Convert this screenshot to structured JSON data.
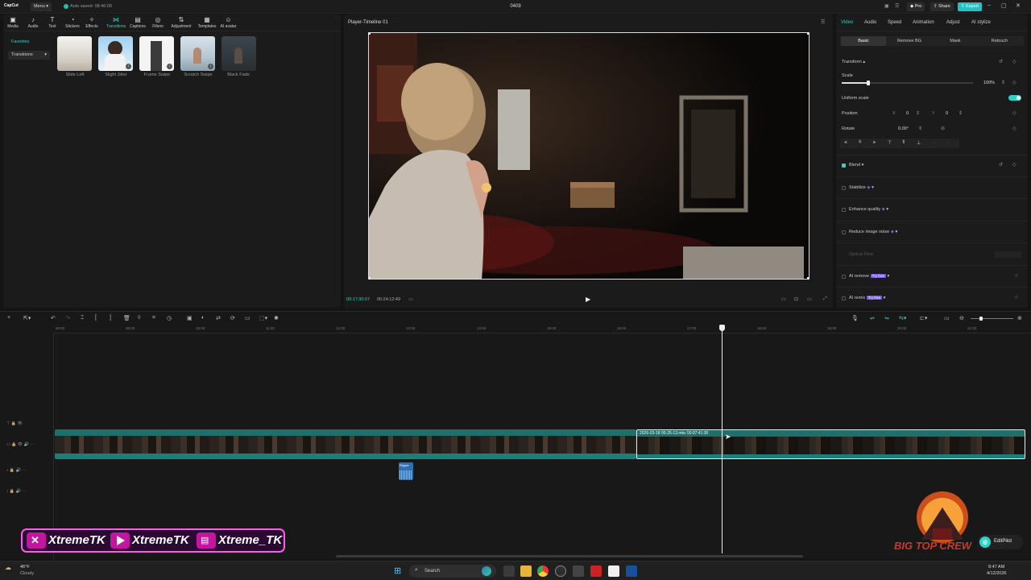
{
  "app": {
    "logo_text": "CapCut",
    "menu_label": "Menu",
    "autosave": "Auto saved: 08:46:09",
    "title": "0409",
    "pro_label": "Pro",
    "share_label": "Share",
    "export_label": "Export"
  },
  "toolbar": {
    "tools": [
      {
        "label": "Media",
        "icon": "media-icon"
      },
      {
        "label": "Audio",
        "icon": "audio-icon"
      },
      {
        "label": "Text",
        "icon": "text-icon"
      },
      {
        "label": "Stickers",
        "icon": "stickers-icon"
      },
      {
        "label": "Effects",
        "icon": "effects-icon"
      },
      {
        "label": "Transitions",
        "icon": "transitions-icon"
      },
      {
        "label": "Captions",
        "icon": "captions-icon"
      },
      {
        "label": "Filters",
        "icon": "filters-icon"
      },
      {
        "label": "Adjustment",
        "icon": "adjustment-icon"
      },
      {
        "label": "Templates",
        "icon": "templates-icon"
      },
      {
        "label": "AI avatar",
        "icon": "ai-avatar-icon"
      }
    ],
    "active_tool": "Transitions"
  },
  "sidebar": {
    "favorites": "Favorites",
    "transitions": "Transitions"
  },
  "transitions": [
    {
      "label": "Slide Left"
    },
    {
      "label": "Slight Jitter"
    },
    {
      "label": "Frame Swipe"
    },
    {
      "label": "Scratch Swipe"
    },
    {
      "label": "Black Fade"
    }
  ],
  "player": {
    "title": "Player-Timeline 01",
    "current_time": "00:17:30:07",
    "total_time": "00:24:12:49"
  },
  "inspector": {
    "tabs": [
      "Video",
      "Audio",
      "Speed",
      "Animation",
      "Adjust",
      "AI stylize"
    ],
    "subtabs": [
      "Basic",
      "Remove BG",
      "Mask",
      "Retouch"
    ],
    "transform": "Transform",
    "scale_label": "Scale",
    "scale_value": "100%",
    "scale_fraction": 0.2,
    "uniform_scale": "Uniform scale",
    "position_label": "Position",
    "pos_x_label": "X",
    "pos_x": "0",
    "pos_y_label": "Y",
    "pos_y": "0",
    "rotate_label": "Rotate",
    "rotate_value": "0.00°",
    "blend": "Blend",
    "stabilize": "Stabilize",
    "enhance": "Enhance quality",
    "reduce_noise": "Reduce image noise",
    "optical_flow": "Optical Flow",
    "ai_remove": "AI remove",
    "ai_remix": "AI remix",
    "try_free": "Try free",
    "accent": "#2fd2c9"
  },
  "timeline": {
    "ruler": [
      "00:00",
      "09:00",
      "10:00",
      "11:00",
      "12:00",
      "13:00",
      "14:00",
      "15:00",
      "16:00",
      "17:00",
      "18:00",
      "19:00",
      "20:00",
      "21:00"
    ],
    "clip_label": "2026-03-18 00-25-13.mkv   00:07:41:30",
    "audio_clip_label": "Ripper"
  },
  "banner": {
    "handle1": "XtremeTK",
    "handle2": "XtremeTK",
    "handle3": "Xtreme_TK"
  },
  "watermark": {
    "text": "BIG TOP CREW",
    "editpilot": "EditPilot"
  },
  "taskbar": {
    "weather_temp": "46°F",
    "weather_desc": "Cloudy",
    "search_placeholder": "Search",
    "time": "8:47 AM",
    "date": "4/12/2026"
  }
}
